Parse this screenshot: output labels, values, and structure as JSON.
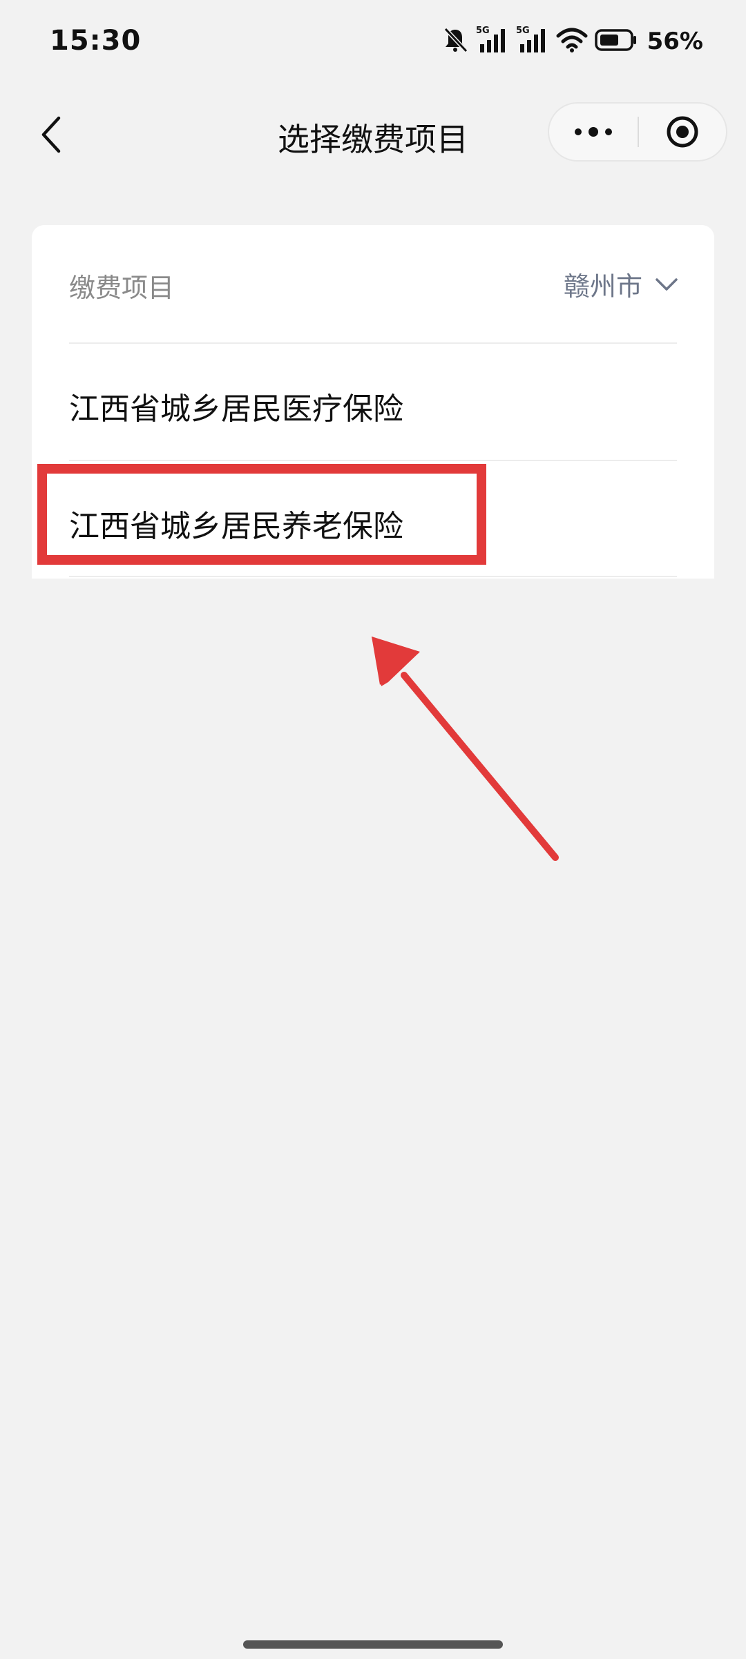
{
  "status_bar": {
    "time": "15:30",
    "network_1": "5G",
    "network_2": "5G",
    "battery_percent": "56%",
    "icons": [
      "bell-muted-icon",
      "signal-5g-icon",
      "signal-5g-icon",
      "wifi-icon",
      "battery-icon"
    ]
  },
  "nav": {
    "title": "选择缴费项目",
    "back_icon": "chevron-left-icon",
    "more_icon": "more-dots-icon",
    "close_icon": "target-circle-icon"
  },
  "card": {
    "header_label": "缴费项目",
    "city": "赣州市",
    "city_icon": "chevron-down-icon",
    "items": [
      {
        "label": "江西省城乡居民医疗保险"
      },
      {
        "label": "江西省城乡居民养老保险"
      }
    ]
  },
  "annotation": {
    "highlight_color": "#e23a3a",
    "highlighted_item_index": 1
  },
  "colors": {
    "background": "#f2f2f2",
    "card": "#ffffff",
    "city_text": "#6d7689",
    "header_text": "#8a8a8a"
  }
}
